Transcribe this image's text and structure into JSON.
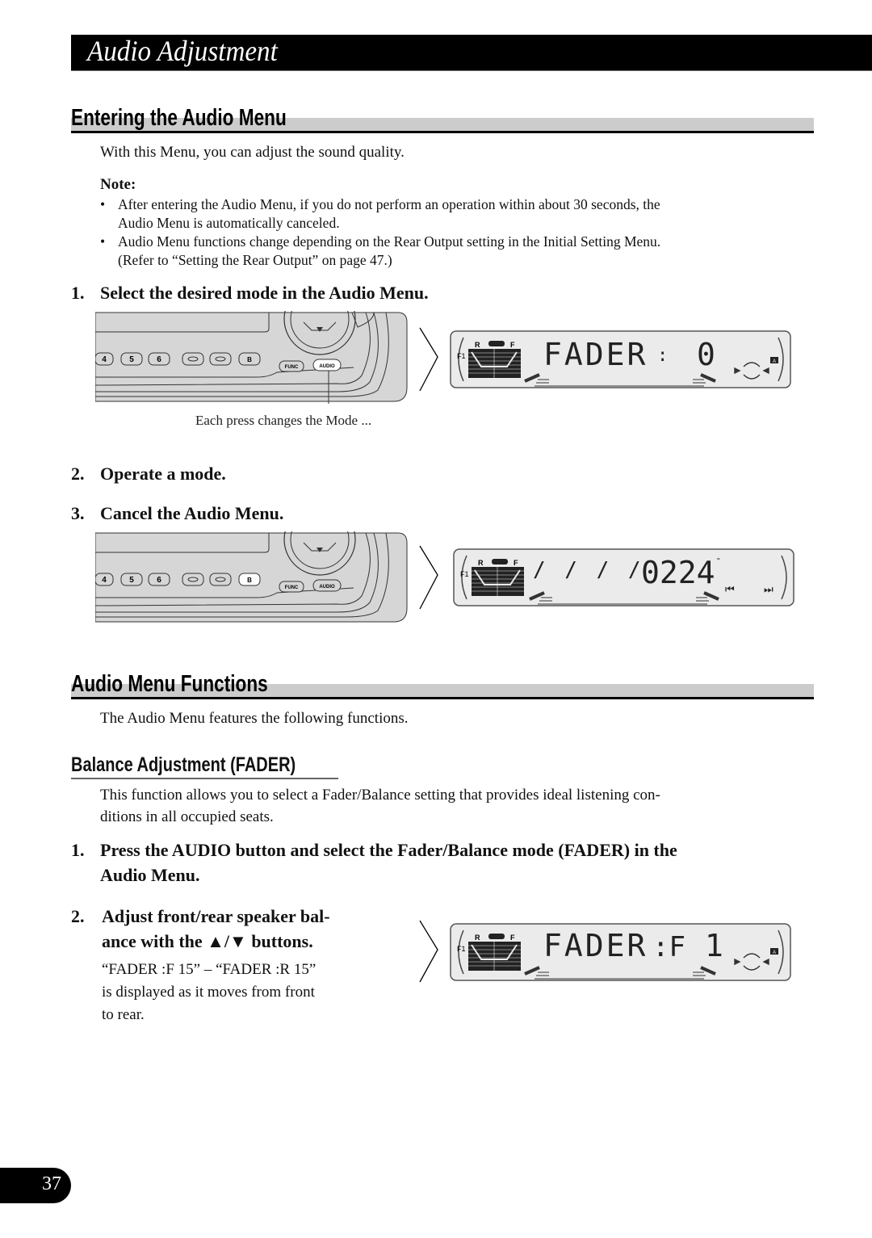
{
  "page": {
    "title": "Audio Adjustment",
    "page_number": "37"
  },
  "section1": {
    "heading": "Entering the Audio Menu",
    "intro": "With this Menu, you can adjust the sound quality.",
    "note_label": "Note:",
    "notes": [
      {
        "line1": "After entering the Audio Menu, if you do not perform an operation within about 30 seconds, the",
        "line2": "Audio Menu is automatically canceled."
      },
      {
        "line1": "Audio Menu functions change depending on the Rear Output setting in the Initial Setting Menu.",
        "line2": "(Refer to “Setting the Rear Output” on page 47.)"
      }
    ],
    "steps": [
      {
        "num": "1.",
        "text": "Select the desired mode in the Audio Menu."
      },
      {
        "num": "2.",
        "text": "Operate a mode."
      },
      {
        "num": "3.",
        "text": "Cancel the Audio Menu."
      }
    ],
    "figure1_caption": "Each press changes the Mode ...",
    "head_unit": {
      "preset_buttons": [
        "4",
        "5",
        "6",
        "",
        "",
        "B"
      ],
      "func_label": "FUNC",
      "audio_label": "AUDIO"
    },
    "lcd1": {
      "left_text": "FADER",
      "separator": ":",
      "value": "0",
      "indicator_r": "R",
      "indicator_f": "F",
      "band": "F1",
      "badge": "A"
    },
    "lcd2": {
      "left_text": "1 1 1 1",
      "value": "0224",
      "time_mark": "\"",
      "indicator_r": "R",
      "indicator_f": "F",
      "band": "F1",
      "prev_icon": "⏮",
      "next_icon": "⏭"
    }
  },
  "section2": {
    "heading": "Audio Menu Functions",
    "intro": "The Audio Menu features the following functions.",
    "subheading": "Balance Adjustment (FADER)",
    "description_line1": "This function allows you to select a Fader/Balance setting that provides ideal listening con-",
    "description_line2": "ditions in all occupied seats.",
    "steps": [
      {
        "num": "1.",
        "line1": "Press the AUDIO button and select the Fader/Balance mode (FADER) in the",
        "line2": "Audio Menu."
      },
      {
        "num": "2.",
        "line1": "Adjust front/rear speaker bal-",
        "line2": "ance with the ▲/▼ buttons."
      }
    ],
    "step2_detail": [
      "“FADER :F 15” – “FADER :R 15”",
      "is displayed as it moves from front",
      "to rear."
    ],
    "lcd3": {
      "left_text": "FADER",
      "separator": ":F",
      "value": "1",
      "indicator_r": "R",
      "indicator_f": "F",
      "band": "F1",
      "badge": "A"
    }
  },
  "colors": {
    "title_bar": "#000000",
    "heading_band": "#cccccc",
    "lcd_bg": "#ebebeb",
    "device_bg": "#d6d6d6"
  }
}
